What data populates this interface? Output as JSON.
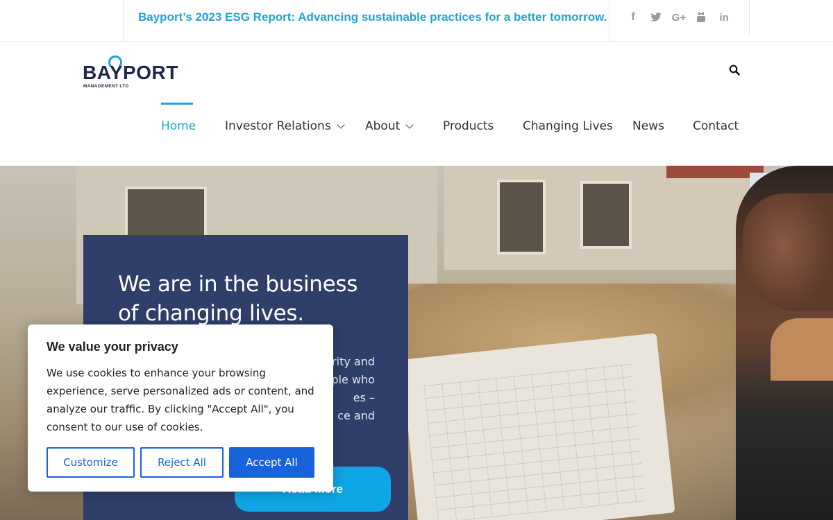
{
  "announcement": {
    "text": "Bayport’s 2023 ESG Report: Advancing sustainable practices for a better tomorrow."
  },
  "socials": [
    {
      "icon": "facebook-icon",
      "glyph": "f"
    },
    {
      "icon": "twitter-icon",
      "glyph": "t"
    },
    {
      "icon": "google-plus-icon",
      "glyph": "G+"
    },
    {
      "icon": "youtube-icon",
      "glyph": "▶"
    },
    {
      "icon": "linkedin-icon",
      "glyph": "in"
    }
  ],
  "logo": {
    "word": "BAYPORT",
    "sub": "MANAGEMENT LTD"
  },
  "nav": {
    "home": "Home",
    "investor_relations": "Investor Relations",
    "about": "About",
    "products": "Products",
    "changing_lives": "Changing Lives",
    "news": "News",
    "contact": "Contact"
  },
  "hero": {
    "title": "We are in the business of changing lives.",
    "text_lines": "rity and\nple who\nes –\nce and",
    "button": "Read More"
  },
  "cookie": {
    "title": "We value your privacy",
    "text": "We use cookies to enhance your browsing experience, serve personalized ads or content, and analyze our traffic. By clicking \"Accept All\", you consent to our use of cookies.",
    "customize": "Customize",
    "reject": "Reject All",
    "accept": "Accept All"
  },
  "colors": {
    "accent": "#1ea3d6",
    "navy": "#2f3f6a",
    "cookie_button": "#1863dc",
    "read_more": "#0fa6e6"
  }
}
